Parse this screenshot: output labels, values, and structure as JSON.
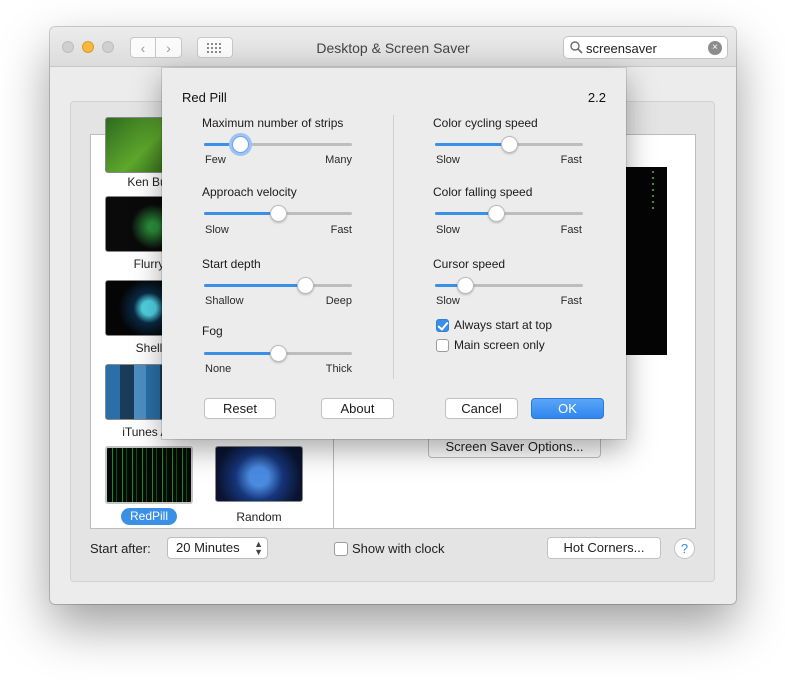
{
  "window": {
    "title": "Desktop & Screen Saver",
    "nav_back": "‹",
    "nav_forward": "›"
  },
  "search": {
    "value": "screensaver",
    "clear": "×"
  },
  "savers": [
    {
      "name": "Ken Burns",
      "label": "Ken Bur"
    },
    {
      "name": "Flurry",
      "label": "Flurry"
    },
    {
      "name": "Shell",
      "label": "Shell"
    },
    {
      "name": "iTunes Artwork",
      "label": "iTunes Art"
    },
    {
      "name": "RedPill",
      "label": "RedPill",
      "selected": true
    },
    {
      "name": "Random",
      "label": "Random"
    }
  ],
  "footer": {
    "start_after_label": "Start after:",
    "start_after_value": "20 Minutes",
    "select_arrows": "▲▼",
    "show_with_clock": "Show with clock",
    "show_with_clock_checked": false,
    "hot_corners": "Hot Corners...",
    "help": "?"
  },
  "preview": {
    "options_button": "Screen Saver Options..."
  },
  "sheet": {
    "title": "Red Pill",
    "version": "2.2",
    "sliders": [
      {
        "key": "max_strips",
        "label": "Maximum number of strips",
        "min_label": "Few",
        "max_label": "Many",
        "value": 0.24,
        "focused": true
      },
      {
        "key": "approach_velocity",
        "label": "Approach velocity",
        "min_label": "Slow",
        "max_label": "Fast",
        "value": 0.5
      },
      {
        "key": "start_depth",
        "label": "Start depth",
        "min_label": "Shallow",
        "max_label": "Deep",
        "value": 0.68
      },
      {
        "key": "fog",
        "label": "Fog",
        "min_label": "None",
        "max_label": "Thick",
        "value": 0.5
      },
      {
        "key": "color_cycling",
        "label": "Color cycling speed",
        "min_label": "Slow",
        "max_label": "Fast",
        "value": 0.5
      },
      {
        "key": "color_falling",
        "label": "Color falling speed",
        "min_label": "Slow",
        "max_label": "Fast",
        "value": 0.41
      },
      {
        "key": "cursor_speed",
        "label": "Cursor speed",
        "min_label": "Slow",
        "max_label": "Fast",
        "value": 0.2
      }
    ],
    "checkboxes": [
      {
        "key": "always_start_top",
        "label": "Always start at top",
        "checked": true
      },
      {
        "key": "main_screen_only",
        "label": "Main screen only",
        "checked": false
      }
    ],
    "buttons": {
      "reset": "Reset",
      "about": "About",
      "cancel": "Cancel",
      "ok": "OK"
    }
  },
  "colors": {
    "accent": "#3a8fe6",
    "window_bg": "#ececec"
  }
}
